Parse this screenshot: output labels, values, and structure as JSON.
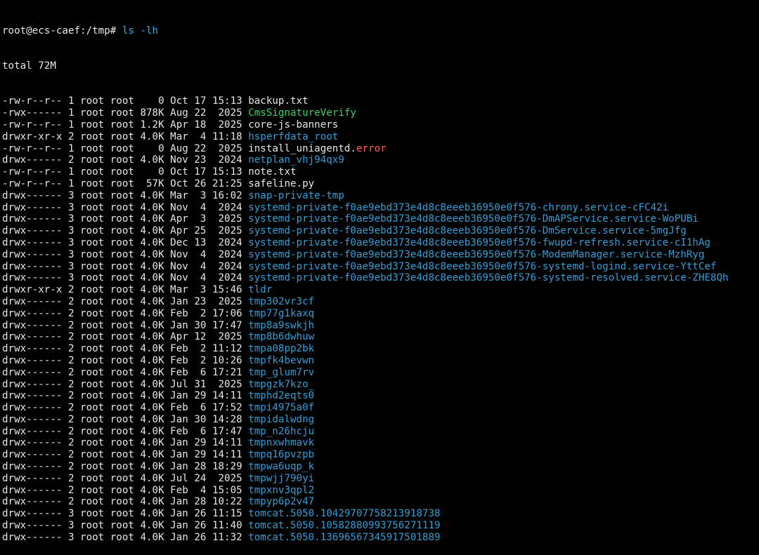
{
  "prompt": {
    "user_host_path": "root@ecs-caef:/tmp# ",
    "command": "ls -lh"
  },
  "total_line": "total 72M",
  "colors": {
    "background": "#000000",
    "text": "#e6e6e6",
    "directory": "#2f9fd6",
    "executable": "#3ad06a",
    "error_suffix": "#ff5f5f",
    "command": "#3fa7e0"
  },
  "entries": [
    {
      "meta": "-rw-r--r-- 1 root root    0 Oct 17 15:13 ",
      "name": "backup.txt",
      "suffix": "",
      "kind": "plain"
    },
    {
      "meta": "-rwx------ 1 root root 878K Aug 22  2025 ",
      "name": "CmsSignatureVerify",
      "suffix": "",
      "kind": "exec"
    },
    {
      "meta": "-rw-r--r-- 1 root root 1.2K Apr 18  2025 ",
      "name": "core-js-banners",
      "suffix": "",
      "kind": "plain"
    },
    {
      "meta": "drwxr-xr-x 2 root root 4.0K Mar  4 11:18 ",
      "name": "hsperfdata_root",
      "suffix": "",
      "kind": "dir"
    },
    {
      "meta": "-rw-r--r-- 1 root root    0 Aug 22  2025 ",
      "name": "install_uniagentd.",
      "suffix": "error",
      "kind": "plain"
    },
    {
      "meta": "drwx------ 2 root root 4.0K Nov 23  2024 ",
      "name": "netplan_vhj94qx9",
      "suffix": "",
      "kind": "dir"
    },
    {
      "meta": "-rw-r--r-- 1 root root    0 Oct 17 15:13 ",
      "name": "note.txt",
      "suffix": "",
      "kind": "plain"
    },
    {
      "meta": "-rw-r--r-- 1 root root  57K Oct 26 21:25 ",
      "name": "safeline.py",
      "suffix": "",
      "kind": "plain"
    },
    {
      "meta": "drwx------ 3 root root 4.0K Mar  3 16:02 ",
      "name": "snap-private-tmp",
      "suffix": "",
      "kind": "dir"
    },
    {
      "meta": "drwx------ 3 root root 4.0K Nov  4  2024 ",
      "name": "systemd-private-f0ae9ebd373e4d8c8eeeb36950e0f576-chrony.service-cFC42i",
      "suffix": "",
      "kind": "dir"
    },
    {
      "meta": "drwx------ 3 root root 4.0K Apr  3  2025 ",
      "name": "systemd-private-f0ae9ebd373e4d8c8eeeb36950e0f576-DmAPService.service-WoPUBi",
      "suffix": "",
      "kind": "dir"
    },
    {
      "meta": "drwx------ 3 root root 4.0K Apr 25  2025 ",
      "name": "systemd-private-f0ae9ebd373e4d8c8eeeb36950e0f576-DmService.service-5mgJfg",
      "suffix": "",
      "kind": "dir"
    },
    {
      "meta": "drwx------ 3 root root 4.0K Dec 13  2024 ",
      "name": "systemd-private-f0ae9ebd373e4d8c8eeeb36950e0f576-fwupd-refresh.service-cI1hAg",
      "suffix": "",
      "kind": "dir"
    },
    {
      "meta": "drwx------ 3 root root 4.0K Nov  4  2024 ",
      "name": "systemd-private-f0ae9ebd373e4d8c8eeeb36950e0f576-ModemManager.service-MzhRyg",
      "suffix": "",
      "kind": "dir"
    },
    {
      "meta": "drwx------ 3 root root 4.0K Nov  4  2024 ",
      "name": "systemd-private-f0ae9ebd373e4d8c8eeeb36950e0f576-systemd-logind.service-YttCef",
      "suffix": "",
      "kind": "dir"
    },
    {
      "meta": "drwx------ 3 root root 4.0K Nov  4  2024 ",
      "name": "systemd-private-f0ae9ebd373e4d8c8eeeb36950e0f576-systemd-resolved.service-ZHE8Qh",
      "suffix": "",
      "kind": "dir"
    },
    {
      "meta": "drwxr-xr-x 2 root root 4.0K Mar  3 15:46 ",
      "name": "tldr",
      "suffix": "",
      "kind": "dir"
    },
    {
      "meta": "drwx------ 2 root root 4.0K Jan 23  2025 ",
      "name": "tmp302vr3cf",
      "suffix": "",
      "kind": "dir"
    },
    {
      "meta": "drwx------ 2 root root 4.0K Feb  2 17:06 ",
      "name": "tmp77g1kaxq",
      "suffix": "",
      "kind": "dir"
    },
    {
      "meta": "drwx------ 2 root root 4.0K Jan 30 17:47 ",
      "name": "tmp8a9swkjh",
      "suffix": "",
      "kind": "dir"
    },
    {
      "meta": "drwx------ 2 root root 4.0K Apr 12  2025 ",
      "name": "tmp8b6dwhuw",
      "suffix": "",
      "kind": "dir"
    },
    {
      "meta": "drwx------ 2 root root 4.0K Feb  2 11:12 ",
      "name": "tmpa08pp2bk",
      "suffix": "",
      "kind": "dir"
    },
    {
      "meta": "drwx------ 2 root root 4.0K Feb  2 10:26 ",
      "name": "tmpfk4bevwn",
      "suffix": "",
      "kind": "dir"
    },
    {
      "meta": "drwx------ 2 root root 4.0K Feb  6 17:21 ",
      "name": "tmp_glum7rv",
      "suffix": "",
      "kind": "dir"
    },
    {
      "meta": "drwx------ 2 root root 4.0K Jul 31  2025 ",
      "name": "tmpgzk7kzo_",
      "suffix": "",
      "kind": "dir"
    },
    {
      "meta": "drwx------ 2 root root 4.0K Jan 29 14:11 ",
      "name": "tmphd2eqts0",
      "suffix": "",
      "kind": "dir"
    },
    {
      "meta": "drwx------ 2 root root 4.0K Feb  6 17:52 ",
      "name": "tmpi4975a0f",
      "suffix": "",
      "kind": "dir"
    },
    {
      "meta": "drwx------ 2 root root 4.0K Jan 30 14:28 ",
      "name": "tmpidalwdng",
      "suffix": "",
      "kind": "dir"
    },
    {
      "meta": "drwx------ 2 root root 4.0K Feb  6 17:47 ",
      "name": "tmp_n26hcju",
      "suffix": "",
      "kind": "dir"
    },
    {
      "meta": "drwx------ 2 root root 4.0K Jan 29 14:11 ",
      "name": "tmpnxwhmavk",
      "suffix": "",
      "kind": "dir"
    },
    {
      "meta": "drwx------ 2 root root 4.0K Jan 29 14:11 ",
      "name": "tmpq16pvzpb",
      "suffix": "",
      "kind": "dir"
    },
    {
      "meta": "drwx------ 2 root root 4.0K Jan 28 18:29 ",
      "name": "tmpwa6uqp_k",
      "suffix": "",
      "kind": "dir"
    },
    {
      "meta": "drwx------ 2 root root 4.0K Jul 24  2025 ",
      "name": "tmpwjj790yi",
      "suffix": "",
      "kind": "dir"
    },
    {
      "meta": "drwx------ 2 root root 4.0K Feb  4 15:05 ",
      "name": "tmpxnv3qpl2",
      "suffix": "",
      "kind": "dir"
    },
    {
      "meta": "drwx------ 2 root root 4.0K Jan 28 10:22 ",
      "name": "tmpyp6p2v47",
      "suffix": "",
      "kind": "dir"
    },
    {
      "meta": "drwx------ 3 root root 4.0K Jan 26 11:15 ",
      "name": "tomcat.5050.10429707758213918738",
      "suffix": "",
      "kind": "dir"
    },
    {
      "meta": "drwx------ 3 root root 4.0K Jan 26 11:40 ",
      "name": "tomcat.5050.10582880993756271119",
      "suffix": "",
      "kind": "dir"
    },
    {
      "meta": "drwx------ 3 root root 4.0K Jan 26 11:32 ",
      "name": "tomcat.5050.13696567345917501889",
      "suffix": "",
      "kind": "dir"
    }
  ]
}
